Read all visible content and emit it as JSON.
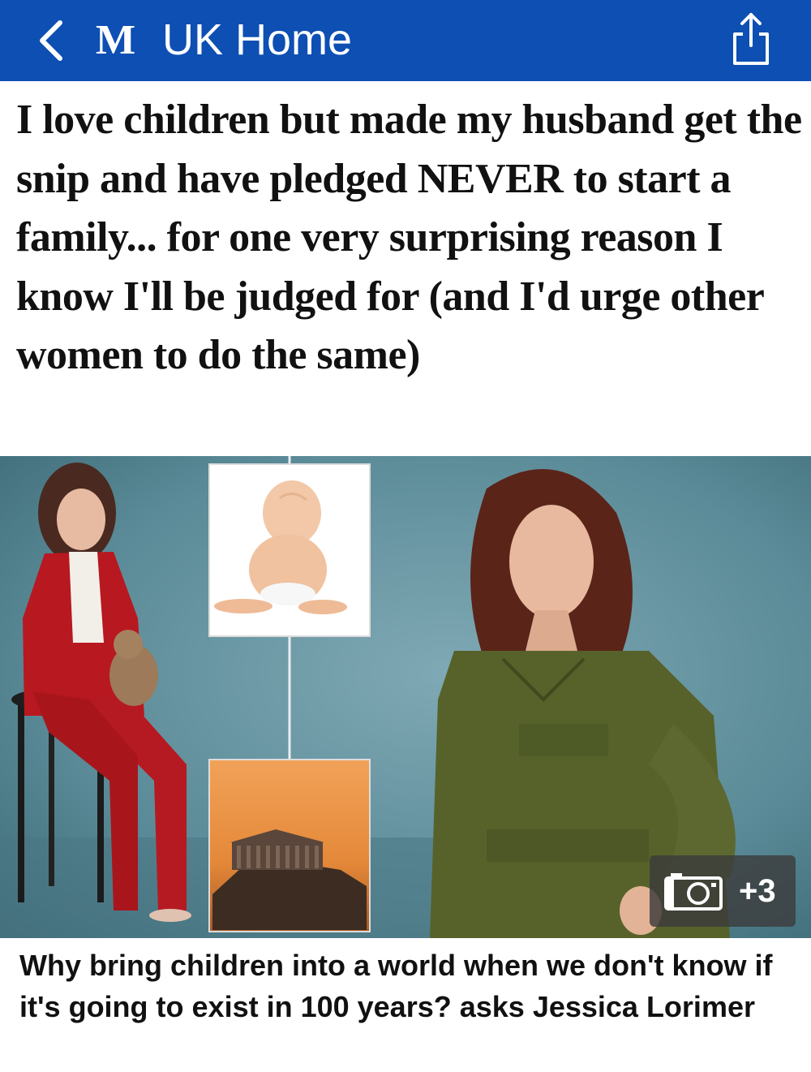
{
  "nav": {
    "logo_text": "M",
    "section_label": "UK Home",
    "back_icon": "chevron-left-icon",
    "share_icon": "share-icon",
    "bar_color": "#0d4fb3"
  },
  "article": {
    "headline": "I love children but made my husband get the snip and have pledged NEVER to start a family... for one very surprising reason I know I'll be judged for (and I'd urge other women to do the same)",
    "gallery_count": "+3",
    "gallery_icon": "camera-icon",
    "caption": "Why bring children into a world when we don't know if it's going to exist in 100 years? asks Jessica Lorimer"
  }
}
